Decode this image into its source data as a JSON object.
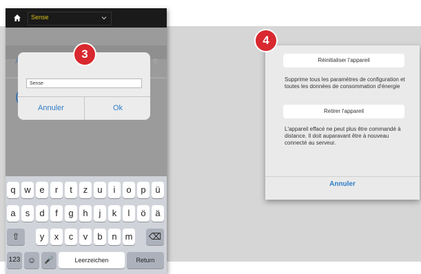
{
  "step_badges": {
    "left": "3",
    "right": "4"
  },
  "left_screen": {
    "app_name": "Sense",
    "icons": [
      "home-icon",
      "chevron-down-icon"
    ],
    "dialog": {
      "input_value": "Sense",
      "cancel_label": "Annuler",
      "ok_label": "Ok"
    },
    "keyboard": {
      "row1": [
        "q",
        "w",
        "e",
        "r",
        "t",
        "z",
        "u",
        "i",
        "o",
        "p",
        "ü"
      ],
      "row2": [
        "a",
        "s",
        "d",
        "f",
        "g",
        "h",
        "j",
        "k",
        "l",
        "ö",
        "ä"
      ],
      "row3": [
        "y",
        "x",
        "c",
        "v",
        "b",
        "n",
        "m"
      ],
      "shift_icon": "⇧",
      "delete_icon": "⌫",
      "numbers_label": "123",
      "emoji_icon": "☺",
      "mic_icon": "🎤",
      "space_label": "Leerzeichen",
      "return_label": "Return"
    }
  },
  "right_panel": {
    "reset_label": "Réinitialiser l'appareil",
    "reset_desc": "Supprime tous les paramètres de configuration et toutes les données de consommation d'énergie",
    "remove_label": "Retirer l'appareil",
    "remove_desc": "L'appareil effacé ne peut plus être commandé à distance. Il doit auparavant être à nouveau connecté au serveur.",
    "cancel_label": "Annuler"
  },
  "colors": {
    "accent_blue": "#2f7cc8",
    "badge_red": "#d9282f",
    "app_name_yellow": "#d9c21a"
  }
}
